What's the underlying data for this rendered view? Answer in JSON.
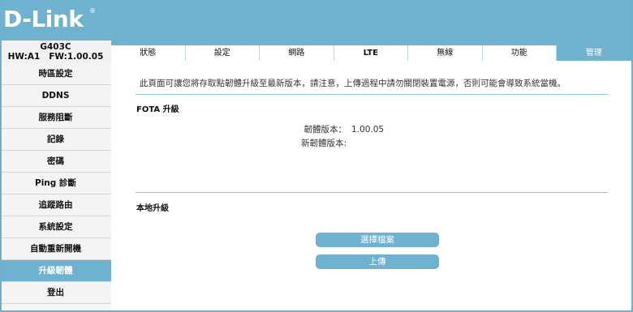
{
  "brand": {
    "logo_text": "D-Link",
    "reg_mark": "®"
  },
  "device": {
    "model": "G403C",
    "hw_fw": "HW:A1   FW:1.00.05"
  },
  "tabs": [
    {
      "label": "狀態"
    },
    {
      "label": "設定"
    },
    {
      "label": "網路"
    },
    {
      "label": "LTE"
    },
    {
      "label": "無線"
    },
    {
      "label": "功能"
    },
    {
      "label": "管理"
    }
  ],
  "active_tab": "管理",
  "sidebar": {
    "items": [
      {
        "label": "時區設定"
      },
      {
        "label": "DDNS"
      },
      {
        "label": "服務阻斷"
      },
      {
        "label": "記錄"
      },
      {
        "label": "密碼"
      },
      {
        "label": "Ping 診斷"
      },
      {
        "label": "追蹤路由"
      },
      {
        "label": "系統設定"
      },
      {
        "label": "自動重新開機"
      },
      {
        "label": "升級韌體"
      },
      {
        "label": "登出"
      }
    ],
    "active_item": "升級韌體"
  },
  "main": {
    "notice": "此頁面可讓您將存取點韌體升級至最新版本，請注意，上傳過程中請勿關閉裝置電源，否則可能會導致系統當機。",
    "fota": {
      "title": "FOTA 升級",
      "firmware_version_label": "韌體版本：",
      "firmware_version_value": "1.00.05",
      "new_firmware_version_label": "新韌體版本:",
      "new_firmware_version_value": ""
    },
    "local": {
      "title": "本地升級",
      "choose_file_label": "選擇檔案",
      "upload_label": "上傳"
    }
  },
  "colors": {
    "accent": "#6fb2cf",
    "divider": "#8cc3da",
    "sidebar_bg": "#f4f4f4"
  }
}
